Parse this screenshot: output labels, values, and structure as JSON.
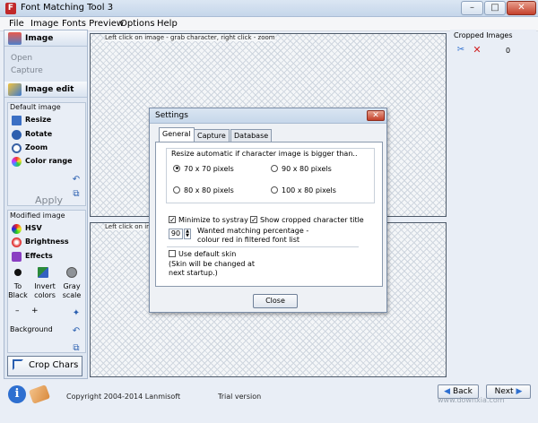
{
  "window": {
    "title": "Font Matching Tool 3",
    "minimize": "–",
    "maximize": "□",
    "close": "✕"
  },
  "menu": [
    "File",
    "Image",
    "Fonts Preview",
    "Options",
    "Help"
  ],
  "left": {
    "image_header": "Image",
    "open": "Open",
    "capture": "Capture",
    "edit_header": "Image edit",
    "default_group": "Default image",
    "default_tools": [
      "Resize",
      "Rotate",
      "Zoom",
      "Color range"
    ],
    "apply": "Apply",
    "modified_group": "Modified image",
    "modified_tools": [
      "HSV",
      "Brightness",
      "Effects"
    ],
    "convert": [
      {
        "label": "To Black"
      },
      {
        "label": "Invert colors"
      },
      {
        "label": "Gray scale"
      }
    ],
    "minus": "–",
    "plus": "+",
    "background": "Background",
    "crop": "Crop Chars"
  },
  "canvas": {
    "top_hint": "Left click on image - grab character, right click - zoom",
    "bottom_hint": "Left click on ir"
  },
  "right": {
    "title": "Cropped Images",
    "count": "0"
  },
  "settings": {
    "title": "Settings",
    "close_icon": "✕",
    "tabs": [
      "General",
      "Capture",
      "Database"
    ],
    "resize_note": "Resize automatic if character image is bigger than..",
    "options": [
      "70 x 70 pixels",
      "90 x 80 pixels",
      "80 x 80 pixels",
      "100 x 80 pixels"
    ],
    "selected_option": "70 x 70 pixels",
    "minimize_systray": "Minimize to systray",
    "show_title": "Show cropped character title",
    "percentage_value": "90",
    "percentage_text": "Wanted matching percentage -  colour red in filtered font list",
    "default_skin": "Use default skin",
    "skin_note": "(Skin will be changed at next startup.)",
    "close_button": "Close"
  },
  "footer": {
    "copyright": "Copyright 2004-2014 Lanmisoft",
    "license": "Trial version",
    "back": "Back",
    "next": "Next",
    "watermark": "www.downxia.com"
  },
  "colors": {
    "accent": "#2e6fd0",
    "app_red": "#c0282a"
  }
}
